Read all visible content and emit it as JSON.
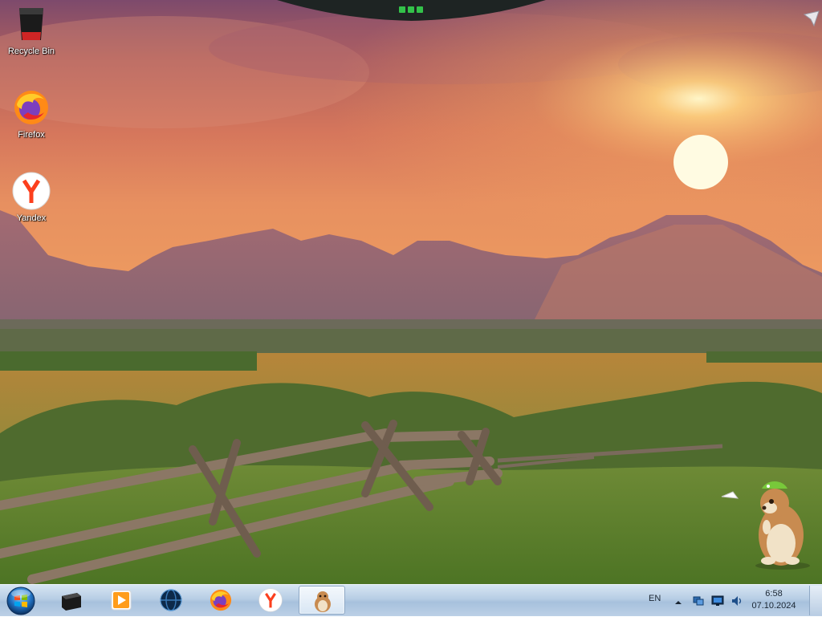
{
  "desktop": {
    "icons": [
      {
        "label": "Recycle Bin",
        "icon": "recycle-bin-icon"
      },
      {
        "label": "Firefox",
        "icon": "firefox-icon"
      },
      {
        "label": "Yandex",
        "icon": "yandex-browser-icon"
      }
    ],
    "wallpaper": "sunset-mountains-meadow-wallpaper",
    "mascot": "hamster-mascot"
  },
  "taskbar": {
    "start": "windows-start-orb",
    "pinned": [
      {
        "icon": "black-box-app-icon"
      },
      {
        "icon": "media-player-icon"
      },
      {
        "icon": "globe-app-icon"
      },
      {
        "icon": "firefox-icon"
      },
      {
        "icon": "yandex-browser-icon"
      },
      {
        "icon": "hamster-app-icon",
        "active": true
      }
    ],
    "tray": {
      "language": "EN",
      "time": "6:58",
      "date": "07.10.2024",
      "icons": [
        "show-hidden-icons-arrow",
        "network-icon",
        "monitor-icon",
        "volume-icon"
      ]
    }
  },
  "colors": {
    "taskbar": "#bcd0e6",
    "sky_top": "#7d4a6c",
    "sun": "#fff6c8"
  }
}
